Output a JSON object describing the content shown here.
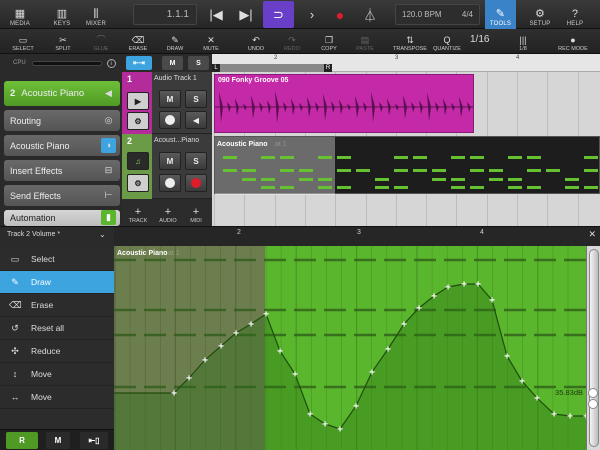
{
  "topbar": {
    "media": "MEDIA",
    "keys": "KEYS",
    "mixer": "MIXER",
    "position": "1.1.1",
    "tempo": "120.0 BPM",
    "signature": "4/4",
    "tools": "TOOLS",
    "setup": "SETUP",
    "help": "HELP"
  },
  "toolbar": {
    "select": "SELECT",
    "split": "SPLIT",
    "glue": "GLUE",
    "erase": "ERASE",
    "draw": "DRAW",
    "mute": "MUTE",
    "undo": "UNDO",
    "redo": "REDO",
    "copy": "COPY",
    "paste": "PASTE",
    "transpose": "TRANSPOSE",
    "quantize": "QUANTIZE",
    "quantize_value": "1/16",
    "grid": "1/8",
    "rec_mode": "REC MODE"
  },
  "inspector": {
    "cpu_label": "CPU",
    "track_number": "2",
    "track_name": "Acoustic Piano",
    "routing": "Routing",
    "instrument": "Acoustic Piano",
    "insert_effects": "Insert Effects",
    "send_effects": "Send Effects",
    "automation": "Automation"
  },
  "track_headers": {
    "chip_m": "M",
    "chip_s": "S",
    "track1": {
      "number": "1",
      "name": "Audio Track 1"
    },
    "track2": {
      "number": "2",
      "name": "Acoust...Piano"
    },
    "m_label": "M",
    "s_label": "S",
    "add_track": "TRACK",
    "add_audio": "AUDIO",
    "add_midi": "MIDI"
  },
  "arrange": {
    "locator_left": "L",
    "locator_right": "R",
    "ruler_marks": [
      "2",
      "3",
      "4"
    ],
    "clip1_name": "090 Fonky Groove 05",
    "clip2_name": "Acoustic Piano",
    "clip2_ghost": "at 1"
  },
  "editor": {
    "parameter": "Track 2 Volume *",
    "ruler_marks": [
      "2",
      "3",
      "4"
    ],
    "event_name": "Acoustic Piano",
    "event_ghost": "at 1",
    "readout": "35.83dB",
    "close": "✕"
  },
  "tools": [
    {
      "label": "Select",
      "icon": "select-icon"
    },
    {
      "label": "Draw",
      "icon": "pencil-icon",
      "active": true
    },
    {
      "label": "Erase",
      "icon": "eraser-icon"
    },
    {
      "label": "Reset all",
      "icon": "reset-icon"
    },
    {
      "label": "Reduce",
      "icon": "reduce-icon"
    },
    {
      "label": "Move",
      "icon": "move-vertical-icon"
    },
    {
      "label": "Move",
      "icon": "move-horizontal-icon"
    }
  ],
  "tool_footer": {
    "r": "R",
    "m": "M"
  },
  "colors": {
    "accent_blue": "#3da4e0",
    "loop_purple": "#6a3fc7",
    "audio_clip": "#c42aa8",
    "instrument_green": "#5ab62c",
    "record_red": "#e01c2b"
  }
}
